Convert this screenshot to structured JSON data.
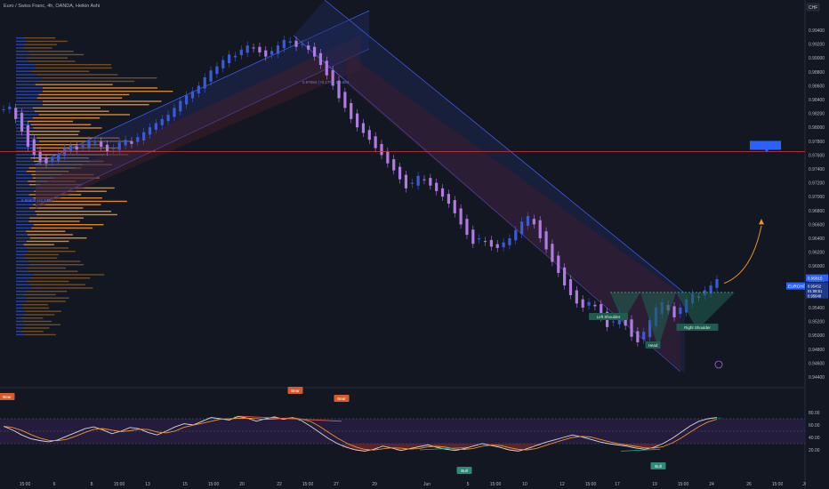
{
  "header": {
    "symbol_title": "Euro / Swiss Franc, 4h, OANDA, Heikin Ashi"
  },
  "colors": {
    "background": "#131722",
    "axis_text": "#b2b5be",
    "bull": "#3a5bd8",
    "bear": "#b07be0",
    "volume_profile": "#f0922e",
    "volume_profile_value": "#2e50c9",
    "channel": "#3e59e6",
    "channel_fill": "#1d2a5a",
    "red_line": "#d63a3a",
    "pattern_green": "#1f5c4e",
    "projection_orange": "#f0922e",
    "oscillator_line": "#d8d8d8",
    "oscillator_signal": "#f0922e",
    "oscillator_band": "#2b1f48"
  },
  "price_axis": {
    "currency": "CHF",
    "ticks": [
      "0.99400",
      "0.99200",
      "0.99000",
      "0.98800",
      "0.98600",
      "0.98400",
      "0.98200",
      "0.98000",
      "0.97800",
      "0.97600",
      "0.97400",
      "0.97200",
      "0.97000",
      "0.96800",
      "0.96600",
      "0.96400",
      "0.96200",
      "0.96000",
      "0.95800",
      "0.95600",
      "0.95400",
      "0.95200",
      "0.95000",
      "0.94800",
      "0.94600",
      "0.94400"
    ],
    "last_price_label": "0.95815",
    "price_box_lines": [
      "0.95452",
      "01:08:51",
      "0.95648"
    ],
    "symbol_tag": "EURCHF"
  },
  "time_axis": {
    "ticks": [
      "15:00",
      "6",
      "8",
      "15:00",
      "13",
      "15",
      "15:00",
      "20",
      "22",
      "15:00",
      "27",
      "29",
      "Jun",
      "5",
      "15:00",
      "10",
      "12",
      "15:00",
      "17",
      "19",
      "15:00",
      "24",
      "26",
      "15:00",
      "Jl"
    ]
  },
  "oscillator_axis": {
    "ticks": [
      "80.00",
      "60.00",
      "40.00",
      "20.00"
    ]
  },
  "annotations": {
    "channel_label": "0.97584 (+0.17%) 1:0.654",
    "poc_label": "0.96900 (+1.13%)",
    "left_shoulder": "Left Shoulder",
    "head": "Head",
    "right_shoulder": "Right Shoulder",
    "bear_tags": [
      "Bear",
      "Bear",
      "Bear"
    ],
    "bull_tags": [
      "Bull",
      "Bull"
    ]
  },
  "chart_data": {
    "type": "line",
    "title": "Euro / Swiss Franc, 4h, OANDA, Heikin Ashi",
    "xlabel": "",
    "ylabel": "",
    "ylim": [
      0.944,
      0.995
    ],
    "candles": {
      "note_type": "heikin_ashi",
      "close_path": [
        0.9826,
        0.983,
        0.9812,
        0.9794,
        0.9772,
        0.976,
        0.9752,
        0.9748,
        0.9756,
        0.9762,
        0.977,
        0.9775,
        0.9768,
        0.9774,
        0.9781,
        0.9778,
        0.9772,
        0.9765,
        0.977,
        0.9778,
        0.9782,
        0.9776,
        0.9786,
        0.9793,
        0.98,
        0.9806,
        0.9812,
        0.9818,
        0.9828,
        0.9838,
        0.9846,
        0.9852,
        0.986,
        0.9872,
        0.9882,
        0.9888,
        0.9897,
        0.9905,
        0.9903,
        0.9912,
        0.9918,
        0.9914,
        0.9908,
        0.9902,
        0.991,
        0.9918,
        0.9926,
        0.9924,
        0.9916,
        0.992,
        0.9912,
        0.9902,
        0.989,
        0.9875,
        0.986,
        0.9842,
        0.9828,
        0.9812,
        0.98,
        0.9792,
        0.9782,
        0.977,
        0.976,
        0.9748,
        0.9738,
        0.9725,
        0.9712,
        0.972,
        0.973,
        0.9724,
        0.9716,
        0.9708,
        0.97,
        0.969,
        0.9676,
        0.966,
        0.9645,
        0.9632,
        0.964,
        0.9635,
        0.9628,
        0.9626,
        0.9634,
        0.964,
        0.9652,
        0.9664,
        0.9672,
        0.966,
        0.964,
        0.9624,
        0.9606,
        0.959,
        0.9572,
        0.9558,
        0.9546,
        0.954,
        0.9548,
        0.9542,
        0.9526,
        0.9512,
        0.952,
        0.9532,
        0.9514,
        0.9498,
        0.949,
        0.9505,
        0.9522,
        0.954,
        0.9548,
        0.9536,
        0.9526,
        0.954,
        0.9552,
        0.956,
        0.9555,
        0.9565,
        0.9572,
        0.9581
      ],
      "last_close": 0.95815
    },
    "horizontal_line": 0.9765,
    "neckline": 0.9562,
    "projection_target": 0.9666,
    "pattern": {
      "name": "Head and Shoulders (inverse)",
      "points": [
        "Left Shoulder",
        "Head",
        "Right Shoulder"
      ]
    },
    "oscillator": {
      "ylim": [
        0,
        100
      ],
      "levels": [
        70,
        30
      ],
      "values": [
        58,
        52,
        44,
        38,
        35,
        33,
        36,
        42,
        48,
        54,
        57,
        52,
        46,
        50,
        56,
        54,
        48,
        44,
        50,
        57,
        62,
        60,
        66,
        72,
        70,
        68,
        74,
        71,
        66,
        70,
        73,
        69,
        72,
        67,
        58,
        48,
        38,
        30,
        24,
        20,
        18,
        21,
        26,
        23,
        19,
        22,
        25,
        28,
        24,
        21,
        19,
        22,
        26,
        30,
        27,
        24,
        20,
        18,
        22,
        27,
        32,
        36,
        40,
        44,
        41,
        37,
        33,
        30,
        28,
        26,
        23,
        21,
        24,
        30,
        38,
        48,
        58,
        66,
        70,
        72
      ]
    }
  }
}
